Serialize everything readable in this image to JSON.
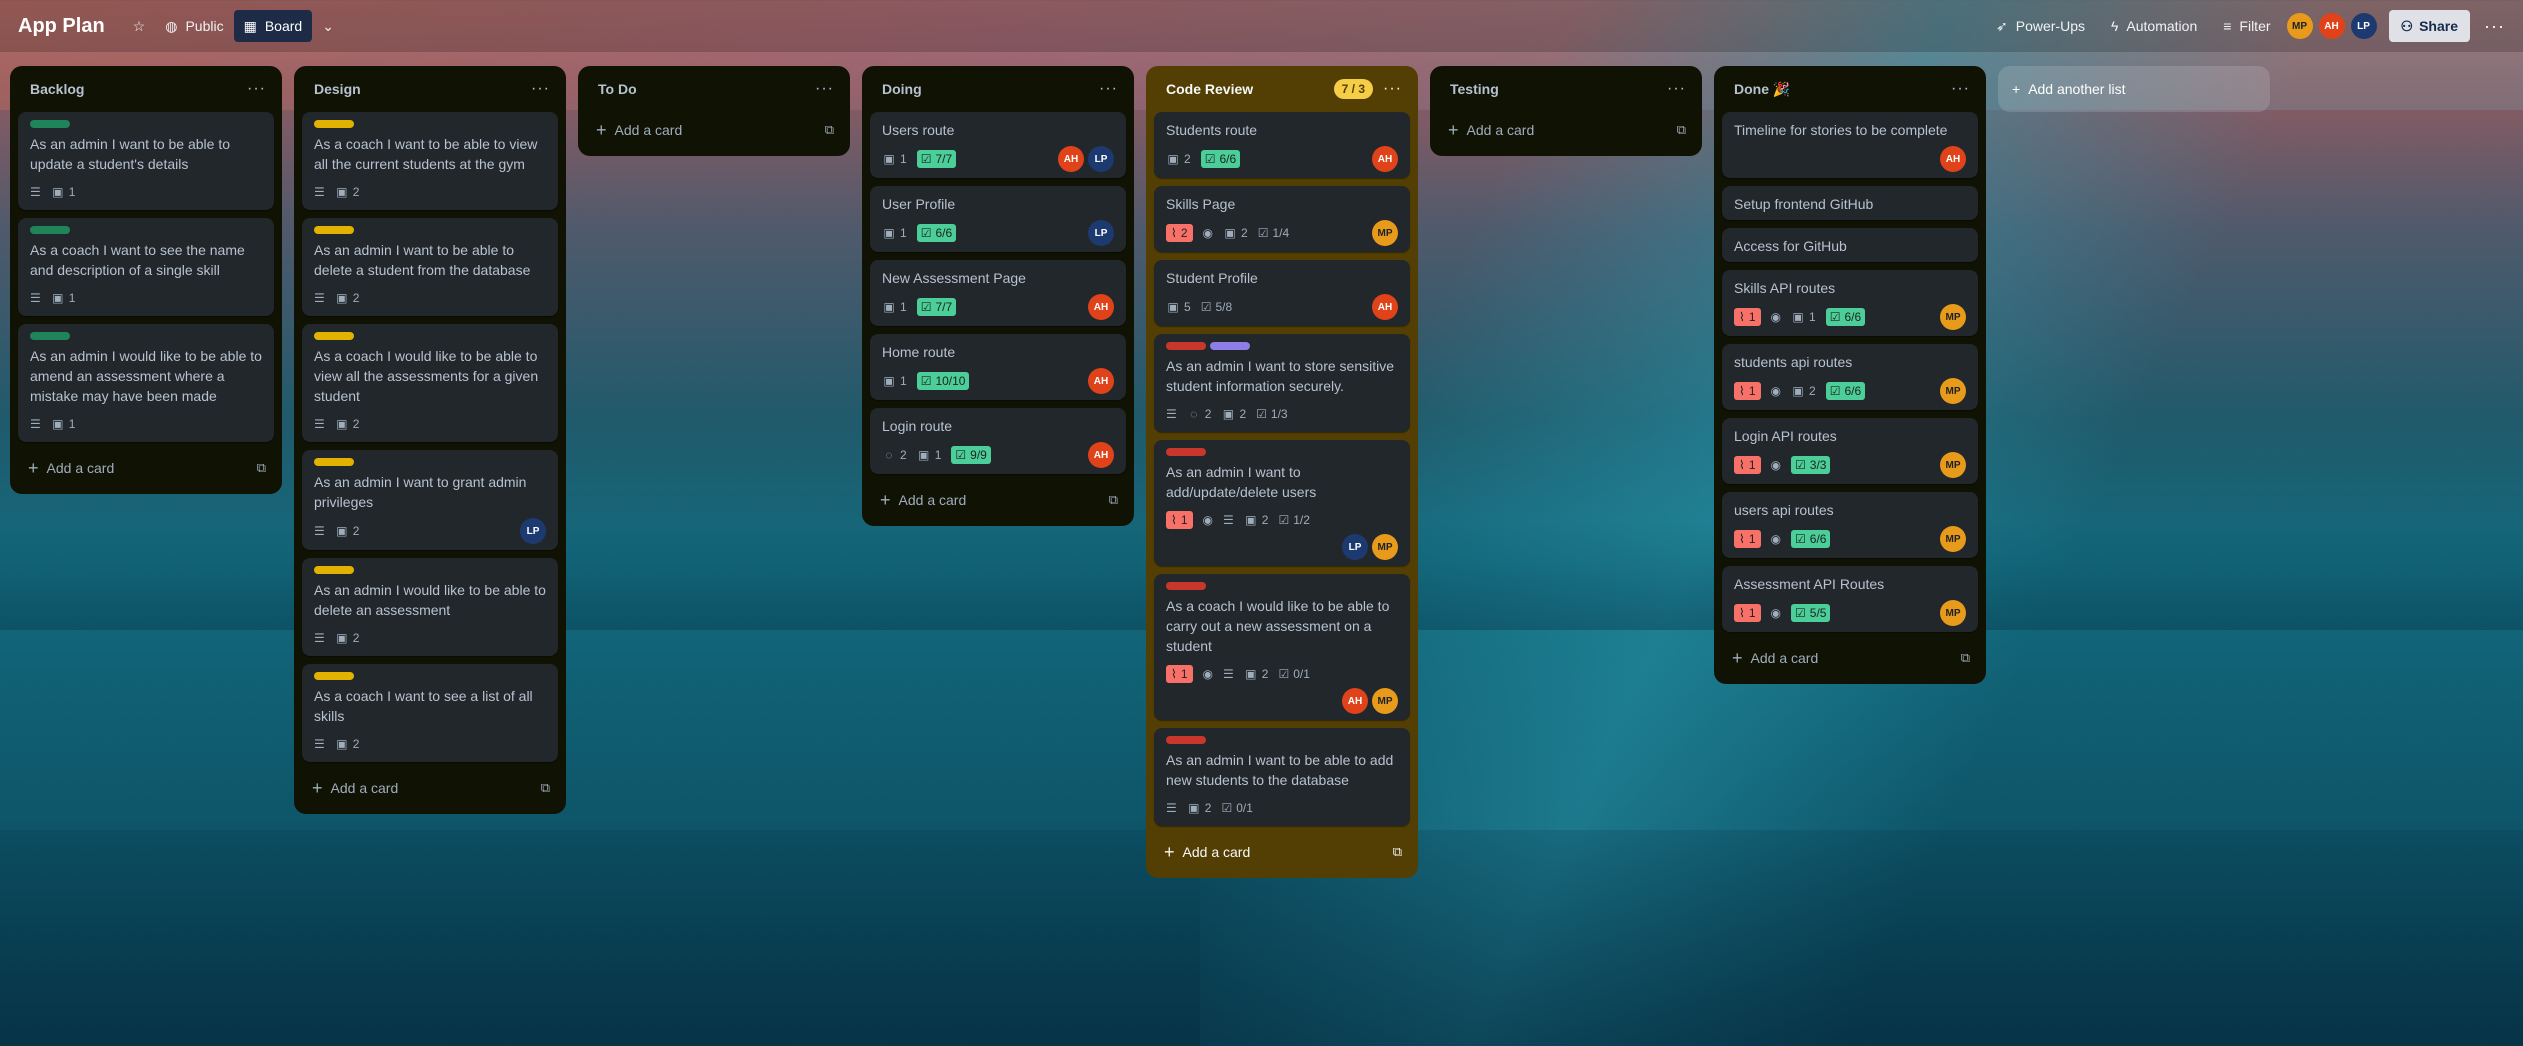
{
  "topbar": {
    "title": "App Plan",
    "visibility": "Public",
    "view": "Board",
    "powerups": "Power-Ups",
    "automation": "Automation",
    "filter": "Filter",
    "members": [
      "MP",
      "AH",
      "LP"
    ],
    "share": "Share"
  },
  "lists": {
    "backlog": {
      "title": "Backlog",
      "add": "Add a card",
      "cards": [
        {
          "title": "As an admin I want to be able to update a student's details",
          "checklist_count": "1"
        },
        {
          "title": "As a coach I want to see the name and description of a single skill",
          "checklist_count": "1"
        },
        {
          "title": "As an admin I would like to be able to amend an assessment where a mistake may have been made",
          "checklist_count": "1"
        }
      ]
    },
    "design": {
      "title": "Design",
      "add": "Add a card",
      "cards": [
        {
          "title": "As a coach I want to be able to view all the current students at the gym",
          "checklist_count": "2"
        },
        {
          "title": "As an admin I want to be able to delete a student from the database",
          "checklist_count": "2"
        },
        {
          "title": "As a coach I would like to be able to view all the assessments for a given student",
          "checklist_count": "2"
        },
        {
          "title": "As an admin I want to grant admin privileges",
          "checklist_count": "2",
          "member": "LP"
        },
        {
          "title": "As an admin I would like to be able to delete an assessment",
          "checklist_count": "2"
        },
        {
          "title": "As a coach I want to see a list of all skills",
          "checklist_count": "2"
        }
      ]
    },
    "todo": {
      "title": "To Do",
      "add": "Add a card"
    },
    "doing": {
      "title": "Doing",
      "add": "Add a card",
      "cards": [
        {
          "title": "Users route",
          "a": "1",
          "check": "7/7",
          "members": [
            "AH",
            "LP"
          ]
        },
        {
          "title": "User Profile",
          "a": "1",
          "check": "6/6",
          "members": [
            "LP"
          ]
        },
        {
          "title": "New Assessment Page",
          "a": "1",
          "check": "7/7",
          "members": [
            "AH"
          ]
        },
        {
          "title": "Home route",
          "a": "1",
          "check": "10/10",
          "members": [
            "AH"
          ]
        },
        {
          "title": "Login route",
          "comments": "2",
          "a": "1",
          "check": "9/9",
          "members": [
            "AH"
          ]
        }
      ]
    },
    "review": {
      "title": "Code Review",
      "wip": "7 / 3",
      "add": "Add a card",
      "cards": [
        {
          "title": "Students route",
          "a": "2",
          "check": "6/6",
          "member": "AH"
        },
        {
          "title": "Skills Page",
          "votes": "2",
          "a": "2",
          "check": "1/4",
          "member": "MP"
        },
        {
          "title": "Student Profile",
          "a": "5",
          "check": "5/8",
          "member": "AH"
        },
        {
          "title": "As an admin I want to store sensitive student information securely.",
          "comments": "2",
          "a": "2",
          "check": "1/3"
        },
        {
          "title": "As an admin I want to add/update/delete users",
          "votes": "1",
          "a": "2",
          "check": "1/2",
          "members": [
            "LP",
            "MP"
          ]
        },
        {
          "title": "As a coach I would like to be able to carry out a new assessment on a student",
          "votes": "1",
          "a": "2",
          "check": "0/1",
          "members": [
            "AH",
            "MP"
          ]
        },
        {
          "title": "As an admin I want to be able to add new students to the database",
          "a": "2",
          "check": "0/1"
        }
      ]
    },
    "testing": {
      "title": "Testing",
      "add": "Add a card"
    },
    "done": {
      "title": "Done 🎉",
      "add": "Add a card",
      "cards": [
        {
          "title": "Timeline for stories to be complete",
          "member": "AH"
        },
        {
          "title": "Setup frontend GitHub"
        },
        {
          "title": "Access for GitHub"
        },
        {
          "title": "Skills API routes",
          "votes": "1",
          "a": "1",
          "check": "6/6",
          "member": "MP"
        },
        {
          "title": "students api routes",
          "votes": "1",
          "a": "2",
          "check": "6/6",
          "member": "MP"
        },
        {
          "title": "Login API routes",
          "votes": "1",
          "check": "3/3",
          "member": "MP"
        },
        {
          "title": "users api routes",
          "votes": "1",
          "check": "6/6",
          "member": "MP"
        },
        {
          "title": "Assessment API Routes",
          "votes": "1",
          "check": "5/5",
          "member": "MP"
        }
      ]
    }
  },
  "add_list": "Add another list",
  "colors": {
    "label_green": "#1f845a",
    "label_yellow": "#e2b203",
    "label_red": "#c9372c",
    "label_purple": "#8f7ee7"
  }
}
